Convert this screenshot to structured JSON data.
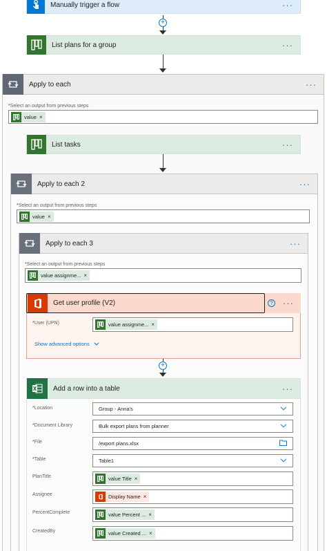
{
  "trigger": {
    "title": "Manually trigger a flow",
    "icon": "touch-trigger-icon"
  },
  "list_plans": {
    "title": "List plans for a group",
    "icon": "planner-icon"
  },
  "apply_each_1": {
    "title": "Apply to each",
    "select_label": "Select an output from previous steps",
    "required_mark": "*",
    "token": "value"
  },
  "list_tasks": {
    "title": "List tasks"
  },
  "apply_each_2": {
    "title": "Apply to each 2",
    "select_label": "Select an output from previous steps",
    "required_mark": "*",
    "token": "value"
  },
  "apply_each_3": {
    "title": "Apply to each 3",
    "select_label": "Select an output from previous steps",
    "required_mark": "*",
    "token": "value assignme..."
  },
  "get_user": {
    "title": "Get user profile (V2)",
    "help": "?",
    "field_label": "User (UPN)",
    "required_mark": "*",
    "token": "value assignme...",
    "advanced": "Show advanced options"
  },
  "add_row": {
    "title": "Add a row into a table",
    "fields": [
      {
        "label": "Location",
        "required": "*",
        "value": "Group - Anna's"
      },
      {
        "label": "Document Library",
        "required": "*",
        "value": "Bulk export plans from planner"
      },
      {
        "label": "File",
        "required": "*",
        "value": "/export plans.xlsx"
      },
      {
        "label": "Table",
        "required": "*",
        "value": "Table1"
      },
      {
        "label": "PlanTitle",
        "required": "",
        "value": "value Title"
      },
      {
        "label": "Assignee",
        "required": "",
        "value": "Display Name"
      },
      {
        "label": "PercentComplete",
        "required": "",
        "value": "value Percent ..."
      },
      {
        "label": "CreatedBy",
        "required": "",
        "value": "value Created ..."
      }
    ]
  },
  "more": "···",
  "remove": "×",
  "colors": {
    "planner": "#31752f",
    "office": "#d83b01",
    "excel": "#217346",
    "accent": "#0078d4"
  }
}
